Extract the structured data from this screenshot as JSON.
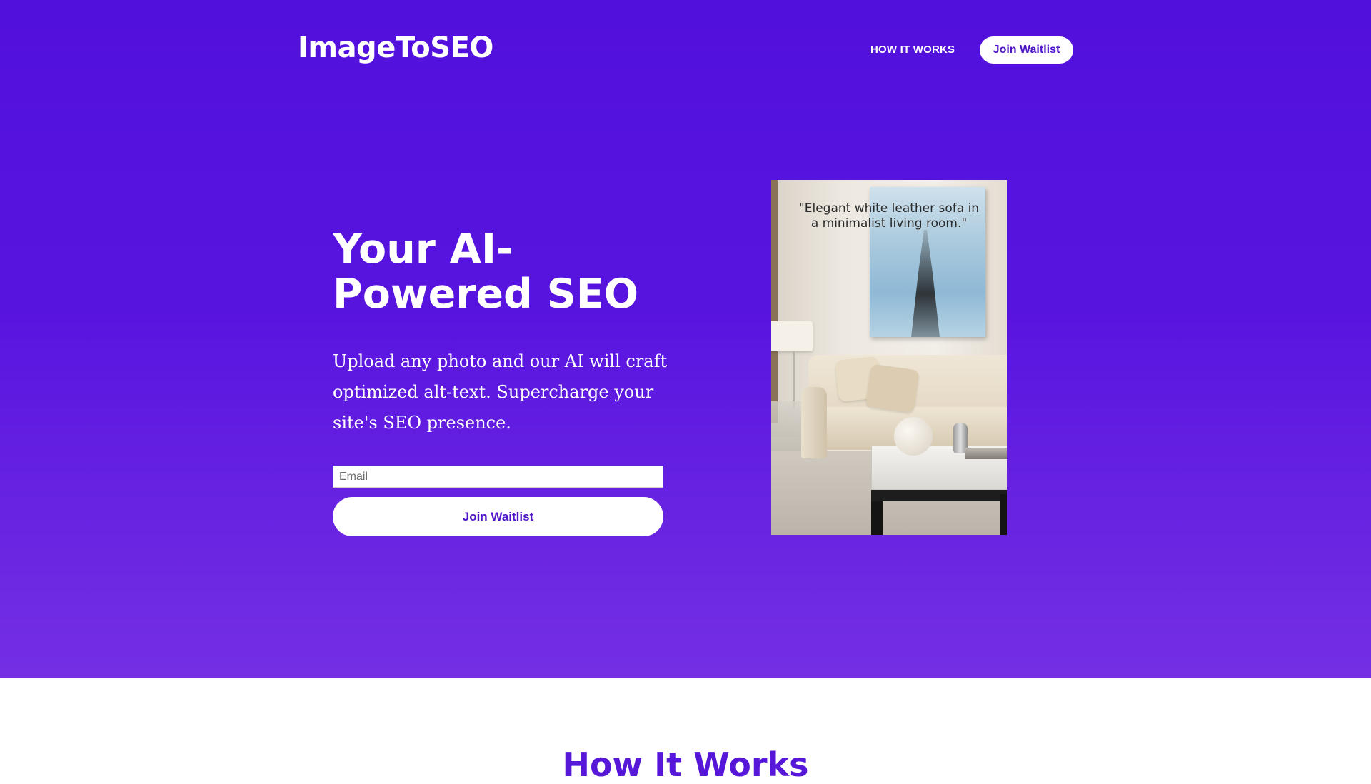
{
  "header": {
    "brand": "ImageToSEO",
    "nav_link": "HOW IT WORKS",
    "cta": "Join Waitlist"
  },
  "hero": {
    "headline_line1": "Your AI-",
    "headline_line2": "Powered SEO",
    "subtext": "Upload any photo and our AI will craft optimized alt-text. Supercharge your site's SEO presence.",
    "email_placeholder": "Email",
    "cta": "Join Waitlist",
    "image_caption_line1": "\"Elegant white leather sofa in",
    "image_caption_line2": "a minimalist living room.\""
  },
  "how_it_works": {
    "title": "How It Works"
  },
  "colors": {
    "hero_top": "#5210dd",
    "hero_bottom": "#742fe4",
    "accent_text": "#4e14c8",
    "section_title": "#5617d9"
  }
}
